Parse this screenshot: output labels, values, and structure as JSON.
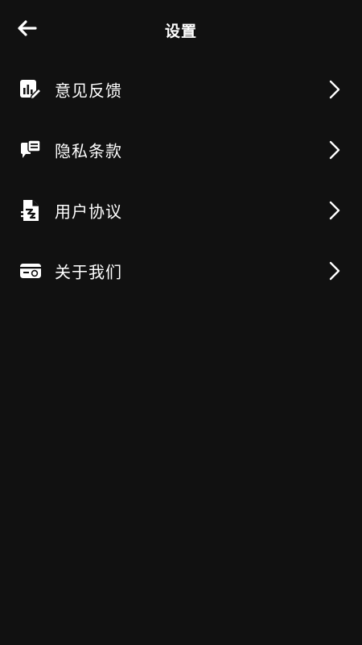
{
  "header": {
    "title": "设置",
    "back_icon": "arrow-left-icon"
  },
  "menu": {
    "items": [
      {
        "label": "意见反馈",
        "icon": "feedback-chart-icon"
      },
      {
        "label": "隐私条款",
        "icon": "chat-bubble-icon"
      },
      {
        "label": "用户协议",
        "icon": "document-icon"
      },
      {
        "label": "关于我们",
        "icon": "id-card-icon"
      }
    ]
  },
  "colors": {
    "background": "#111111",
    "text": "#ffffff"
  }
}
